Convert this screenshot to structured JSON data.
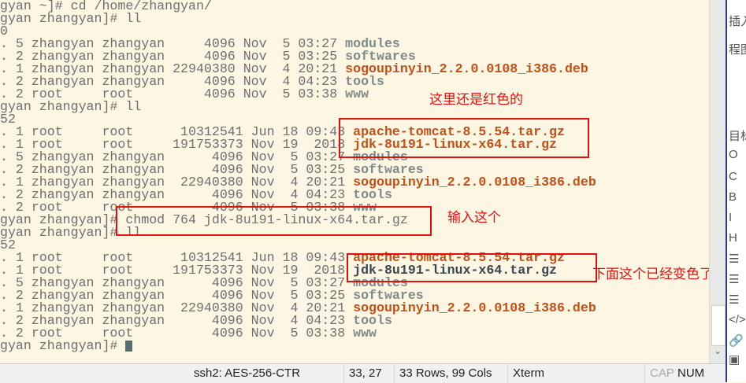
{
  "terminal": {
    "lines": [
      {
        "text": "gyan ~]# cd /home/zhangyan/",
        "file": "",
        "kind": ""
      },
      {
        "text": "gyan zhangyan]# ll",
        "file": "",
        "kind": ""
      },
      {
        "text": "0",
        "file": "",
        "kind": ""
      },
      {
        "text": ". 5 zhangyan zhangyan     4096 Nov  5 03:27 ",
        "file": "modules",
        "kind": "dir"
      },
      {
        "text": ". 2 zhangyan zhangyan     4096 Nov  5 03:25 ",
        "file": "softwares",
        "kind": "dir"
      },
      {
        "text": ". 1 zhangyan zhangyan 22940380 Nov  4 20:21 ",
        "file": "sogoupinyin_2.2.0.0108_i386.deb",
        "kind": "red"
      },
      {
        "text": ". 2 zhangyan zhangyan     4096 Nov  4 04:23 ",
        "file": "tools",
        "kind": "dir"
      },
      {
        "text": ". 2 root     root         4096 Nov  5 03:38 ",
        "file": "www",
        "kind": "dir"
      },
      {
        "text": "gyan zhangyan]# ll",
        "file": "",
        "kind": ""
      },
      {
        "text": "52",
        "file": "",
        "kind": ""
      },
      {
        "text": ". 1 root     root      10312541 Jun 18 09:43 ",
        "file": "apache-tomcat-8.5.54.tar.gz",
        "kind": "red"
      },
      {
        "text": ". 1 root     root     191753373 Nov 19  2018 ",
        "file": "jdk-8u191-linux-x64.tar.gz",
        "kind": "red"
      },
      {
        "text": ". 5 zhangyan zhangyan      4096 Nov  5 03:27 ",
        "file": "modules",
        "kind": "dir"
      },
      {
        "text": ". 2 zhangyan zhangyan      4096 Nov  5 03:25 ",
        "file": "softwares",
        "kind": "dir"
      },
      {
        "text": ". 1 zhangyan zhangyan  22940380 Nov  4 20:21 ",
        "file": "sogoupinyin_2.2.0.0108_i386.deb",
        "kind": "red"
      },
      {
        "text": ". 2 zhangyan zhangyan      4096 Nov  4 04:23 ",
        "file": "tools",
        "kind": "dir"
      },
      {
        "text": ". 2 root     root          4096 Nov  5 03:38 ",
        "file": "www",
        "kind": "dir"
      },
      {
        "text": "gyan zhangyan]# chmod 764 jdk-8u191-linux-x64.tar.gz",
        "file": "",
        "kind": ""
      },
      {
        "text": "gyan zhangyan]# ll",
        "file": "",
        "kind": ""
      },
      {
        "text": "52",
        "file": "",
        "kind": ""
      },
      {
        "text": ". 1 root     root      10312541 Jun 18 09:43 ",
        "file": "apache-tomcat-8.5.54.tar.gz",
        "kind": "red"
      },
      {
        "text": ". 1 root     root     191753373 Nov 19  2018 ",
        "file": "jdk-8u191-linux-x64.tar.gz",
        "kind": "exec"
      },
      {
        "text": ". 5 zhangyan zhangyan      4096 Nov  5 03:27 ",
        "file": "modules",
        "kind": "dir"
      },
      {
        "text": ". 2 zhangyan zhangyan      4096 Nov  5 03:25 ",
        "file": "softwares",
        "kind": "dir"
      },
      {
        "text": ". 1 zhangyan zhangyan  22940380 Nov  4 20:21 ",
        "file": "sogoupinyin_2.2.0.0108_i386.deb",
        "kind": "red"
      },
      {
        "text": ". 2 zhangyan zhangyan      4096 Nov  4 04:23 ",
        "file": "tools",
        "kind": "dir"
      },
      {
        "text": ". 2 root     root          4096 Nov  5 03:38 ",
        "file": "www",
        "kind": "dir"
      },
      {
        "text": "gyan zhangyan]# ",
        "file": "",
        "kind": "prompt"
      }
    ]
  },
  "annotations": {
    "still_red": "这里还是红色的",
    "type_this": "输入这个",
    "changed_color": "下面这个已经变色了"
  },
  "status_bar": {
    "encryption": "ssh2: AES-256-CTR",
    "cursor_pos": "33, 27",
    "size": "33 Rows, 99 Cols",
    "term_type": "Xterm",
    "cap": "CAP",
    "num": "NUM"
  },
  "right_panel": {
    "items": [
      "插入",
      "程图",
      "目标",
      "O",
      "C",
      "B",
      "I",
      "H",
      "☰",
      "☰",
      "☰",
      "</>",
      "🔗",
      "▣"
    ]
  },
  "colors": {
    "background": "#fdf6e3",
    "red_file": "#c2501a",
    "dir": "#7d8b8b",
    "exec": "#3b4750",
    "annotation": "#e01010"
  }
}
